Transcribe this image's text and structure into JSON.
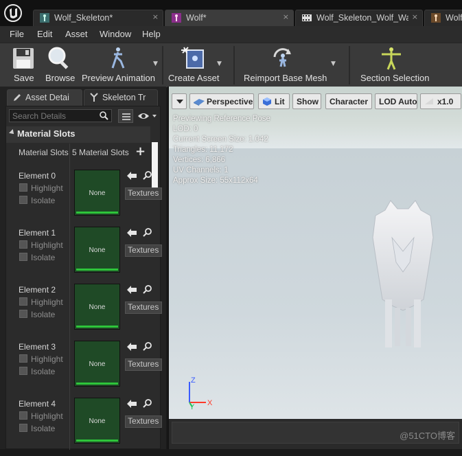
{
  "tabs": [
    {
      "label": "Wolf_Skeleton*",
      "icon": "skeleton-icon",
      "active": false
    },
    {
      "label": "Wolf*",
      "icon": "skeletal-mesh-icon",
      "active": true
    },
    {
      "label": "Wolf_Skeleton_Wolf_Walk*",
      "icon": "animation-icon",
      "active": false
    },
    {
      "label": "Wolf",
      "icon": "physics-asset-icon",
      "active": false
    }
  ],
  "tab_close": "×",
  "menu": [
    "File",
    "Edit",
    "Asset",
    "Window",
    "Help"
  ],
  "toolbar": {
    "save": "Save",
    "browse": "Browse",
    "preview_animation": "Preview Animation",
    "create_asset": "Create Asset",
    "reimport": "Reimport Base Mesh",
    "section_selection": "Section Selection"
  },
  "left_panel": {
    "tabs": [
      "Asset Detai",
      "Skeleton Tr"
    ],
    "search_placeholder": "Search Details",
    "section_title": "Material Slots",
    "slots_label": "Material Slots",
    "slots_count": "5 Material Slots",
    "add_symbol": "+",
    "elements": [
      {
        "name": "Element 0",
        "highlight": "Highlight",
        "isolate": "Isolate",
        "material": "None",
        "dropdown": "Textures"
      },
      {
        "name": "Element 1",
        "highlight": "Highlight",
        "isolate": "Isolate",
        "material": "None",
        "dropdown": "Textures"
      },
      {
        "name": "Element 2",
        "highlight": "Highlight",
        "isolate": "Isolate",
        "material": "None",
        "dropdown": "Textures"
      },
      {
        "name": "Element 3",
        "highlight": "Highlight",
        "isolate": "Isolate",
        "material": "None",
        "dropdown": "Textures"
      },
      {
        "name": "Element 4",
        "highlight": "Highlight",
        "isolate": "Isolate",
        "material": "None",
        "dropdown": "Textures"
      }
    ]
  },
  "viewport": {
    "buttons": {
      "perspective": "Perspective",
      "lit": "Lit",
      "show": "Show",
      "character": "Character",
      "lod": "LOD Auto",
      "speed": "x1.0"
    },
    "stats": [
      "Previewing Reference Pose",
      "LOD: 0",
      "Current Screen Size: 1.042",
      "Triangles: 11,172",
      "Vertices: 6,866",
      "UV Channels: 1",
      "Approx Size: 55x112x64"
    ],
    "axis": {
      "z": "Z",
      "y": "Y",
      "x": "X",
      "z_color": "#3a5cff",
      "y_color": "#22c55e",
      "x_color": "#ff3a2a"
    }
  },
  "watermark": "@51CTO博客",
  "colors": {
    "slot_green": "#1f4a26",
    "slot_bar": "#2ec53a",
    "ue_logo": "#f2f2f2"
  }
}
